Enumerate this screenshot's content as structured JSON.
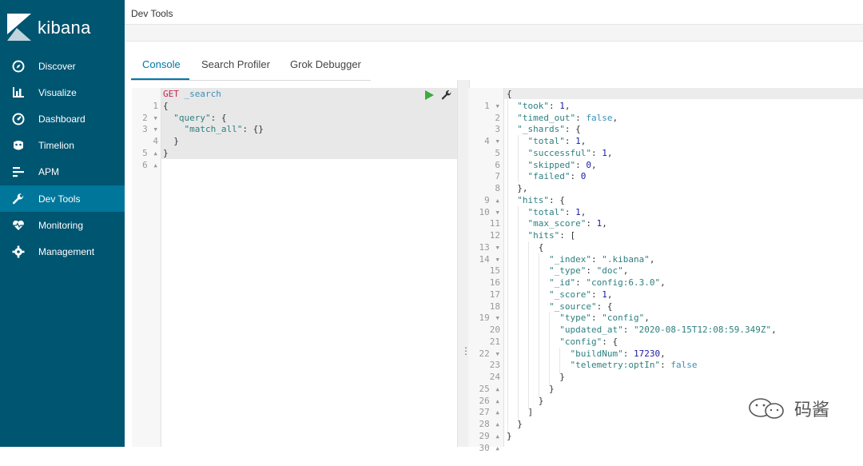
{
  "sidebar": {
    "brand": "kibana",
    "items": [
      {
        "label": "Discover",
        "icon": "compass-icon"
      },
      {
        "label": "Visualize",
        "icon": "bar-chart-icon"
      },
      {
        "label": "Dashboard",
        "icon": "dashboard-icon"
      },
      {
        "label": "Timelion",
        "icon": "timelion-icon"
      },
      {
        "label": "APM",
        "icon": "apm-icon"
      },
      {
        "label": "Dev Tools",
        "icon": "wrench-icon",
        "active": true
      },
      {
        "label": "Monitoring",
        "icon": "heartbeat-icon"
      },
      {
        "label": "Management",
        "icon": "gear-icon"
      }
    ]
  },
  "page": {
    "title": "Dev Tools"
  },
  "tabs": [
    {
      "label": "Console",
      "active": true
    },
    {
      "label": "Search Profiler"
    },
    {
      "label": "Grok Debugger"
    }
  ],
  "request": {
    "method": "GET",
    "path": " _search",
    "gutter": [
      "1",
      "2 ▾",
      "3 ▾",
      "4",
      "5 ▴",
      "6 ▴"
    ]
  },
  "response": {
    "gutter": [
      "1 ▾",
      "2",
      "3",
      "4 ▾",
      "5",
      "6",
      "7",
      "8",
      "9 ▴",
      "10 ▾",
      "11",
      "12",
      "13 ▾",
      "14 ▾",
      "15",
      "16",
      "17",
      "18",
      "19 ▾",
      "20",
      "21",
      "22 ▾",
      "23",
      "24",
      "25 ▴",
      "26 ▴",
      "27 ▴",
      "28 ▴",
      "29 ▴",
      "30 ▴"
    ]
  },
  "watermark": {
    "text": "码酱"
  },
  "colors": {
    "sidebar": "#005571",
    "active_nav": "#00769a",
    "accent": "#0079a5"
  }
}
